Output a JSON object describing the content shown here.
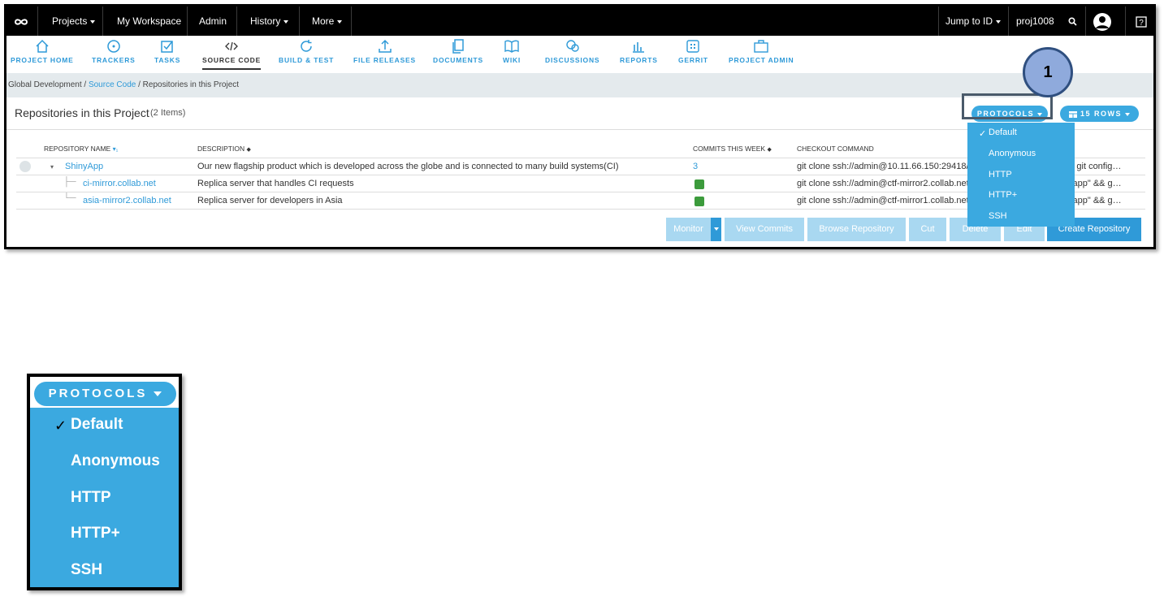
{
  "topnav": {
    "projects": "Projects",
    "workspace": "My Workspace",
    "admin": "Admin",
    "history": "History",
    "more": "More",
    "jump": "Jump to ID",
    "project_id": "proj1008"
  },
  "tools": [
    "PROJECT HOME",
    "TRACKERS",
    "TASKS",
    "SOURCE CODE",
    "BUILD & TEST",
    "FILE RELEASES",
    "DOCUMENTS",
    "WIKI",
    "DISCUSSIONS",
    "REPORTS",
    "GERRIT",
    "PROJECT ADMIN"
  ],
  "breadcrumb": {
    "root": "Global Development",
    "section": "Source Code",
    "current": "Repositories in this Project"
  },
  "page": {
    "title": "Repositories in this Project",
    "count": "(2 Items)",
    "protocols_label": "PROTOCOLS",
    "rows_label": "15 ROWS",
    "callout": "1"
  },
  "table": {
    "headers": [
      "REPOSITORY NAME",
      "DESCRIPTION",
      "COMMITS THIS WEEK",
      "CHECKOUT COMMAND"
    ],
    "rows": [
      {
        "name": "ShinyApp",
        "description": "Our new flagship product which is developed across the globe and is connected to many build systems(CI)",
        "commits": "3",
        "checkout": "git clone ssh://admin@10.11.66.150:29418/sh",
        "checkout_tail": "& git config…"
      },
      {
        "name": "ci-mirror.collab.net",
        "description": "Replica server that handles CI requests",
        "commits": "",
        "checkout": "git clone ssh://admin@ctf-mirror2.collab.net",
        "checkout_tail": "yapp\" && g…"
      },
      {
        "name": "asia-mirror2.collab.net",
        "description": "Replica server for developers in Asia",
        "commits": "",
        "checkout": "git clone ssh://admin@ctf-mirror1.collab.net",
        "checkout_tail": "yapp\" && g…"
      }
    ]
  },
  "actions": {
    "monitor": "Monitor",
    "view_commits": "View Commits",
    "browse": "Browse Repository",
    "cut": "Cut",
    "delete": "Delete",
    "edit": "Edit",
    "create": "Create Repository"
  },
  "dropdown": {
    "options": [
      "Default",
      "Anonymous",
      "HTTP",
      "HTTP+",
      "SSH"
    ],
    "selected": "Default"
  },
  "colors": {
    "accent": "#3ba9e0",
    "link": "#2f9ad8",
    "callout": "#8faadc"
  }
}
